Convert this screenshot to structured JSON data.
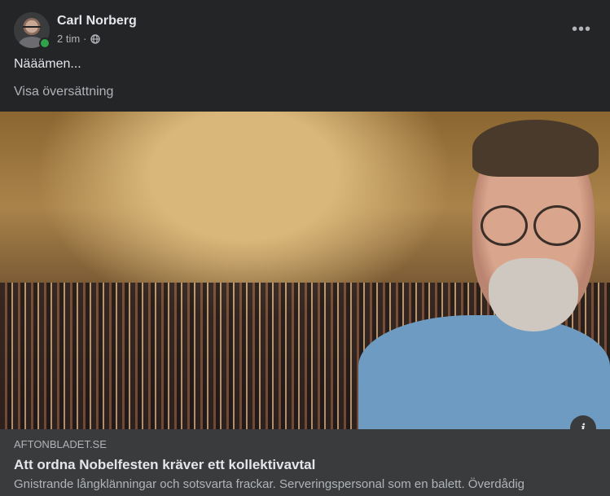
{
  "post": {
    "author": "Carl Norberg",
    "time": "2 tim",
    "separator": "·",
    "privacy_icon": "globe-icon",
    "more_label": "•••",
    "text": "Nääämen...",
    "translate_label": "Visa översättning"
  },
  "link_preview": {
    "domain": "AFTONBLADET.SE",
    "headline": "Att ordna Nobelfesten kräver ett kollektivavtal",
    "description": "Gnistrande långklänningar och sotsvarta frackar. Serveringspersonal som en balett. Överdådig",
    "info_label": "i"
  },
  "colors": {
    "background": "#242526",
    "link_meta_background": "#3a3b3c",
    "primary_text": "#e4e6eb",
    "secondary_text": "#b0b3b8",
    "online": "#31a24c"
  }
}
